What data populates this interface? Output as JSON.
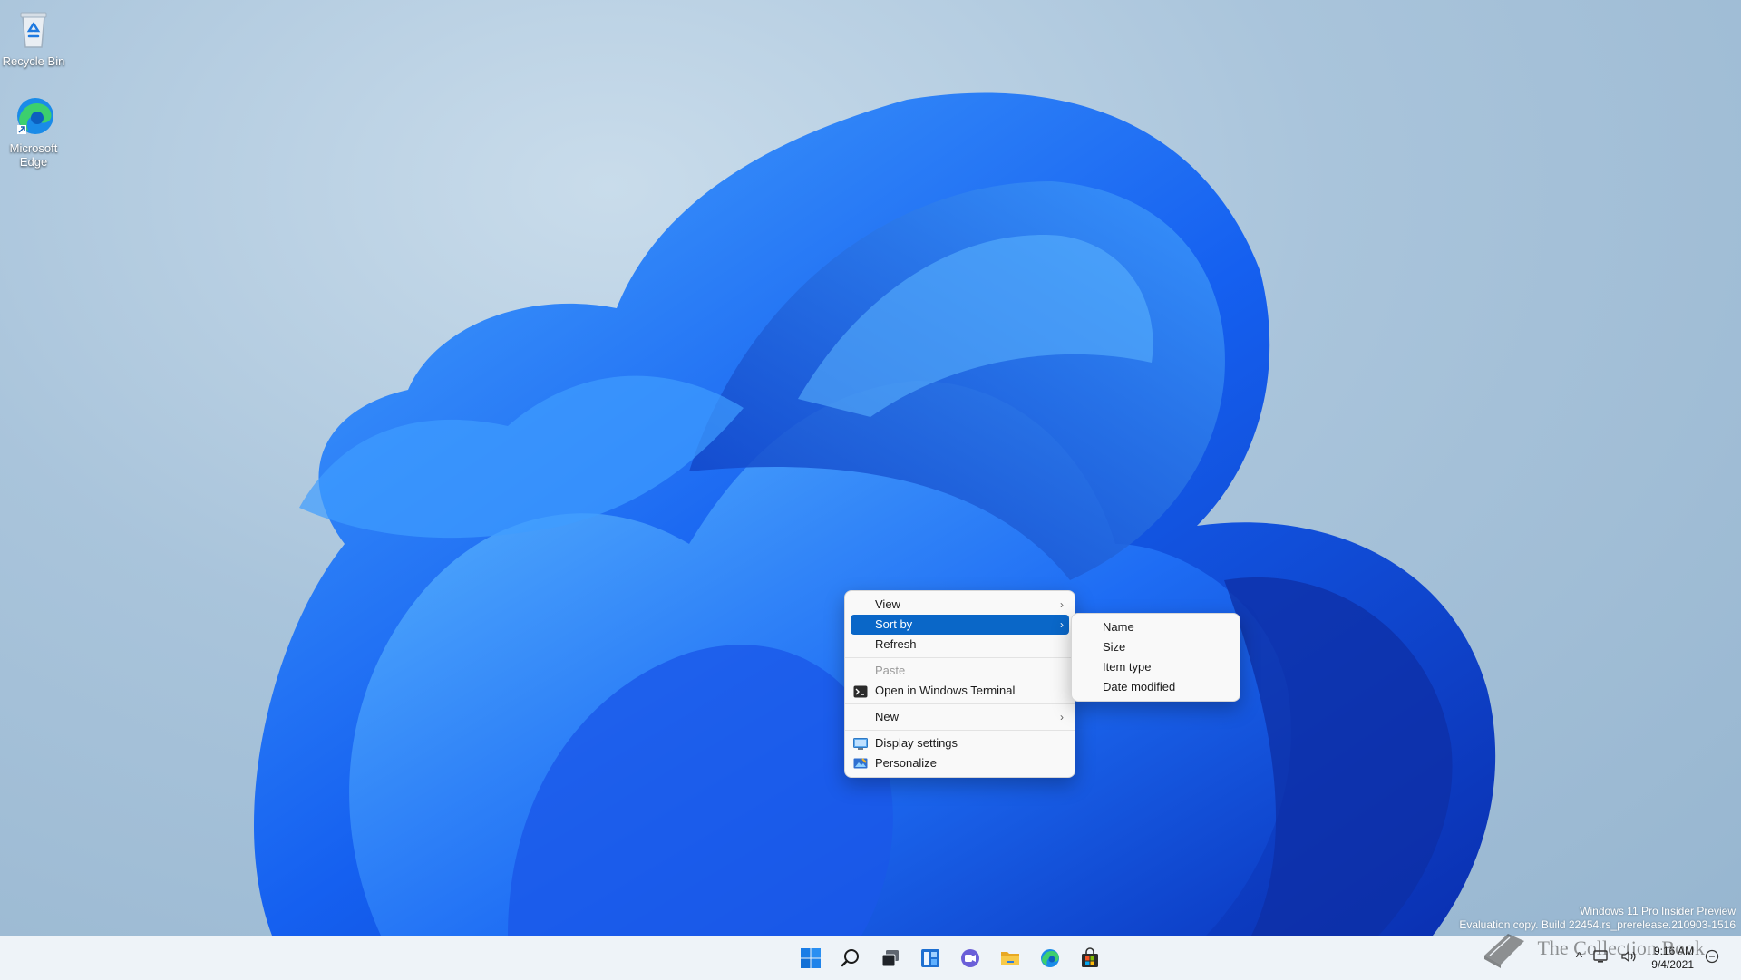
{
  "desktop": {
    "icons": [
      {
        "label": "Recycle Bin",
        "icon": "recycle-bin-icon"
      },
      {
        "label": "Microsoft Edge",
        "icon": "edge-icon"
      }
    ],
    "watermark": {
      "line1": "Windows 11 Pro Insider Preview",
      "line2": "Evaluation copy. Build 22454.rs_prerelease.210903-1516"
    }
  },
  "context_menu": {
    "items": [
      {
        "label": "View",
        "has_submenu": true
      },
      {
        "label": "Sort by",
        "has_submenu": true,
        "highlighted": true
      },
      {
        "label": "Refresh"
      },
      {
        "label": "Paste",
        "disabled": true
      },
      {
        "label": "Open in Windows Terminal",
        "icon": "terminal-icon"
      },
      {
        "label": "New",
        "has_submenu": true
      },
      {
        "label": "Display settings",
        "icon": "display-icon"
      },
      {
        "label": "Personalize",
        "icon": "personalize-icon"
      }
    ],
    "chevron": "›"
  },
  "submenu_sort_by": {
    "items": [
      "Name",
      "Size",
      "Item type",
      "Date modified"
    ]
  },
  "taskbar": {
    "apps": [
      "start-icon",
      "search-icon",
      "task-view-icon",
      "widgets-icon",
      "chat-icon",
      "file-explorer-icon",
      "edge-icon",
      "store-icon"
    ],
    "tray": {
      "chevron": "^",
      "time": "9:16 AM",
      "date": "9/4/2021"
    }
  },
  "overlay_logo": {
    "text": "The Collection Book"
  },
  "colors": {
    "accent": "#0a67c8",
    "menu_bg": "#f9f9f9",
    "taskbar_bg": "#eef3f8"
  }
}
